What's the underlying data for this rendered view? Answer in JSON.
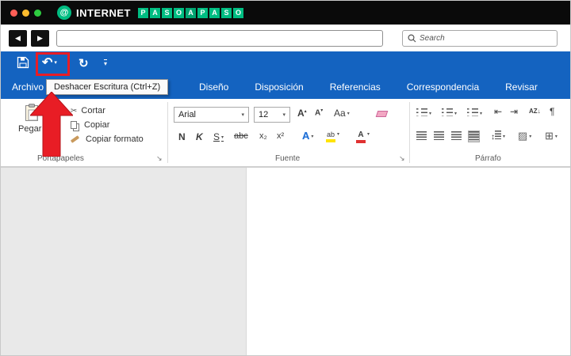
{
  "brand": {
    "at_symbol": "@",
    "word": "INTERNET",
    "tiles": [
      "P",
      "A",
      "S",
      "O",
      "A",
      "P",
      "A",
      "S",
      "O"
    ],
    "green": "#00bd82"
  },
  "window_controls": {
    "close_color": "#ff5f57",
    "minimize_color": "#febc2e",
    "maximize_color": "#2ecc40"
  },
  "browser": {
    "back_icon": "◀",
    "forward_icon": "▶",
    "address_value": "",
    "search_placeholder": "Search"
  },
  "quick_access": {
    "undo_icon": "↶",
    "undo_caret": "▾",
    "redo_icon": "↻",
    "customize_caret": "▾"
  },
  "tooltip": {
    "text": "Deshacer Escritura (Ctrl+Z)"
  },
  "tabs": [
    "Archivo",
    "Diseño",
    "Disposición",
    "Referencias",
    "Correspondencia",
    "Revisar"
  ],
  "clipboard": {
    "paste_label": "Pegar",
    "paste_caret": "▾",
    "cut_label": "Cortar",
    "cut_icon": "✂",
    "copy_label": "Copiar",
    "format_label": "Copiar formato",
    "group_label": "Portapapeles",
    "launcher_icon": "↘"
  },
  "font": {
    "family": "Arial",
    "size": "12",
    "combo_caret": "▾",
    "grow_label": "A",
    "grow_caret": "▴",
    "shrink_label": "A",
    "shrink_caret": "▾",
    "case_label": "Aa",
    "case_caret": "▾",
    "bold_label": "N",
    "italic_label": "K",
    "underline_label": "S",
    "underline_caret": "▾",
    "strike_label": "abc",
    "subscript_label": "x₂",
    "superscript_label": "x²",
    "effects_label": "A",
    "effects_caret": "▾",
    "highlight_label": "ab",
    "highlight_color": "#ffe400",
    "highlight_caret": "▾",
    "color_label": "A",
    "color_bar": "#e03131",
    "color_caret": "▾",
    "group_label": "Fuente",
    "launcher_icon": "↘"
  },
  "paragraph": {
    "caret": "▾",
    "indent_decrease_icon": "⇤",
    "indent_increase_icon": "⇥",
    "sort_icon": "AZ↓",
    "pilcrow_icon": "¶",
    "line_spacing_icon": "↕",
    "shading_icon": "▨",
    "borders_icon": "⊞",
    "group_label": "Párrafo"
  },
  "colors": {
    "ribbon_blue": "#1463c0",
    "annotation_red": "#e81d25"
  }
}
